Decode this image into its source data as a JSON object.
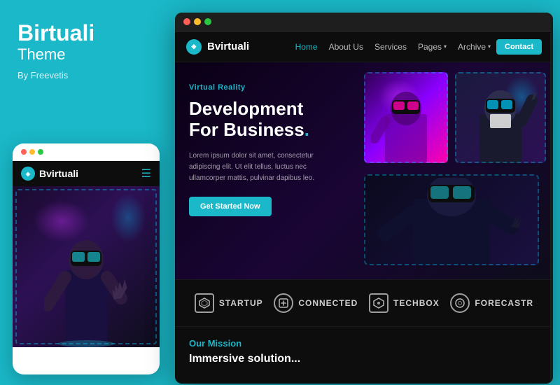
{
  "left": {
    "brand": "Birtuali",
    "sub": "Theme",
    "by": "By Freevetis"
  },
  "mobile": {
    "logo_text": "Bvirtuali",
    "dots": [
      {
        "color": "#ff5f57"
      },
      {
        "color": "#ffbd2e"
      },
      {
        "color": "#28c840"
      }
    ]
  },
  "browser": {
    "dots": [
      {
        "color": "#ff5f57"
      },
      {
        "color": "#ffbd2e"
      },
      {
        "color": "#28c840"
      }
    ]
  },
  "navbar": {
    "logo": "Bvirtuali",
    "links": [
      {
        "label": "Home",
        "active": true
      },
      {
        "label": "About Us",
        "active": false
      },
      {
        "label": "Services",
        "active": false
      },
      {
        "label": "Pages",
        "active": false,
        "dropdown": true
      },
      {
        "label": "Archive",
        "active": false,
        "dropdown": true
      }
    ],
    "cta": "Contact"
  },
  "hero": {
    "tag": "Virtual Reality",
    "title_line1": "Development",
    "title_line2": "For Business",
    "dot": ".",
    "desc": "Lorem ipsum dolor sit amet, consectetur adipiscing elit. Ut elit tellus, luctus nec ullamcorper mattis, pulvinar dapibus leo.",
    "btn": "Get Started Now"
  },
  "brands": [
    {
      "icon": "◈",
      "label": "STARTUP"
    },
    {
      "icon": "⬡",
      "label": "CONNECTED"
    },
    {
      "icon": "◈",
      "label": "TECHBOX"
    },
    {
      "icon": "◎",
      "label": "forecastr"
    }
  ],
  "mission": {
    "tag": "Our Mission",
    "title": "Immersive solution..."
  }
}
